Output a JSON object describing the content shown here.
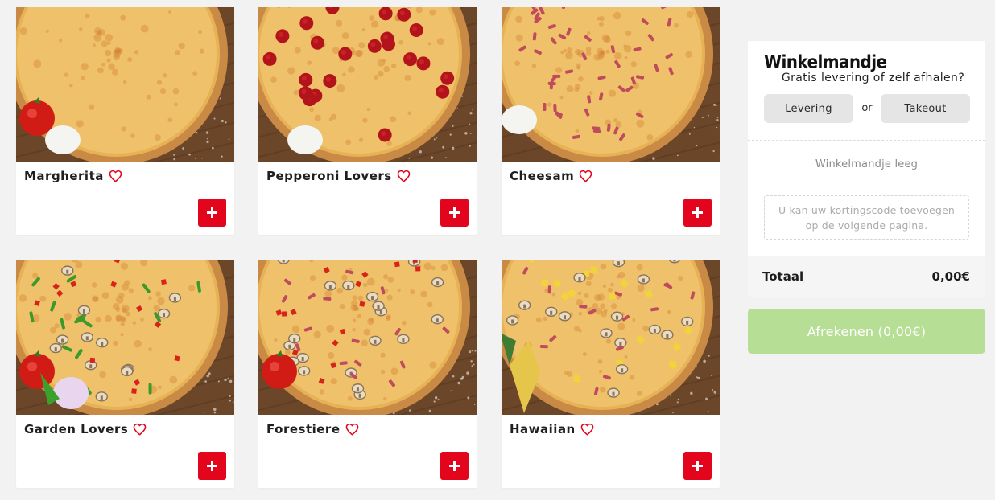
{
  "products": [
    {
      "name": "Margherita",
      "toppings": []
    },
    {
      "name": "Pepperoni Lovers",
      "toppings": [
        "pepperoni"
      ]
    },
    {
      "name": "Cheesam",
      "toppings": [
        "ham"
      ]
    },
    {
      "name": "Garden Lovers",
      "toppings": [
        "pepper",
        "mushroom",
        "tomato"
      ]
    },
    {
      "name": "Forestiere",
      "toppings": [
        "mushroom",
        "ham",
        "tomato"
      ]
    },
    {
      "name": "Hawaiian",
      "toppings": [
        "pineapple",
        "mushroom",
        "ham"
      ]
    }
  ],
  "icons": {
    "favorite": "heart-outline-icon",
    "add": "plus-icon"
  },
  "cart": {
    "title": "Winkelmandje",
    "subtitle": "Gratis levering of zelf afhalen?",
    "delivery_label": "Levering",
    "or_label": "or",
    "takeout_label": "Takeout",
    "empty_text": "Winkelmandje leeg",
    "coupon_text": "U kan uw kortingscode toevoegen op de volgende pagina.",
    "total_label": "Totaal",
    "total_value": "0,00€",
    "checkout_label": "Afrekenen (0,00€)"
  },
  "colors": {
    "brand_red": "#e3051b",
    "checkout_disabled": "#b6df95",
    "toggle_bg": "#e5e5e5",
    "page_bg": "#f2f2f2"
  }
}
